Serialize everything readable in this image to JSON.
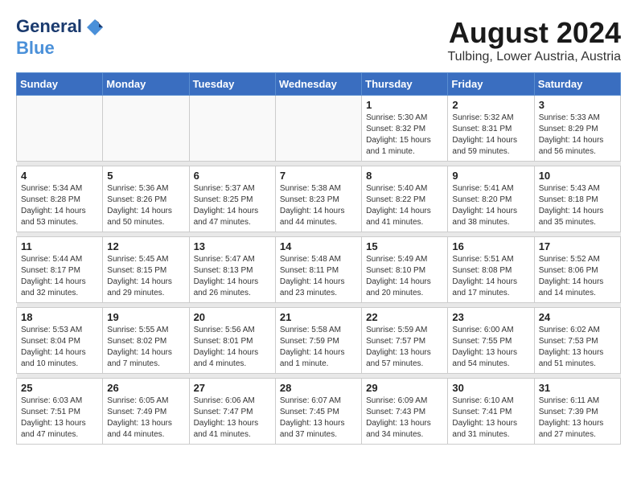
{
  "logo": {
    "line1": "General",
    "line2": "Blue"
  },
  "title": "August 2024",
  "location": "Tulbing, Lower Austria, Austria",
  "weekdays": [
    "Sunday",
    "Monday",
    "Tuesday",
    "Wednesday",
    "Thursday",
    "Friday",
    "Saturday"
  ],
  "weeks": [
    [
      {
        "day": "",
        "info": ""
      },
      {
        "day": "",
        "info": ""
      },
      {
        "day": "",
        "info": ""
      },
      {
        "day": "",
        "info": ""
      },
      {
        "day": "1",
        "info": "Sunrise: 5:30 AM\nSunset: 8:32 PM\nDaylight: 15 hours\nand 1 minute."
      },
      {
        "day": "2",
        "info": "Sunrise: 5:32 AM\nSunset: 8:31 PM\nDaylight: 14 hours\nand 59 minutes."
      },
      {
        "day": "3",
        "info": "Sunrise: 5:33 AM\nSunset: 8:29 PM\nDaylight: 14 hours\nand 56 minutes."
      }
    ],
    [
      {
        "day": "4",
        "info": "Sunrise: 5:34 AM\nSunset: 8:28 PM\nDaylight: 14 hours\nand 53 minutes."
      },
      {
        "day": "5",
        "info": "Sunrise: 5:36 AM\nSunset: 8:26 PM\nDaylight: 14 hours\nand 50 minutes."
      },
      {
        "day": "6",
        "info": "Sunrise: 5:37 AM\nSunset: 8:25 PM\nDaylight: 14 hours\nand 47 minutes."
      },
      {
        "day": "7",
        "info": "Sunrise: 5:38 AM\nSunset: 8:23 PM\nDaylight: 14 hours\nand 44 minutes."
      },
      {
        "day": "8",
        "info": "Sunrise: 5:40 AM\nSunset: 8:22 PM\nDaylight: 14 hours\nand 41 minutes."
      },
      {
        "day": "9",
        "info": "Sunrise: 5:41 AM\nSunset: 8:20 PM\nDaylight: 14 hours\nand 38 minutes."
      },
      {
        "day": "10",
        "info": "Sunrise: 5:43 AM\nSunset: 8:18 PM\nDaylight: 14 hours\nand 35 minutes."
      }
    ],
    [
      {
        "day": "11",
        "info": "Sunrise: 5:44 AM\nSunset: 8:17 PM\nDaylight: 14 hours\nand 32 minutes."
      },
      {
        "day": "12",
        "info": "Sunrise: 5:45 AM\nSunset: 8:15 PM\nDaylight: 14 hours\nand 29 minutes."
      },
      {
        "day": "13",
        "info": "Sunrise: 5:47 AM\nSunset: 8:13 PM\nDaylight: 14 hours\nand 26 minutes."
      },
      {
        "day": "14",
        "info": "Sunrise: 5:48 AM\nSunset: 8:11 PM\nDaylight: 14 hours\nand 23 minutes."
      },
      {
        "day": "15",
        "info": "Sunrise: 5:49 AM\nSunset: 8:10 PM\nDaylight: 14 hours\nand 20 minutes."
      },
      {
        "day": "16",
        "info": "Sunrise: 5:51 AM\nSunset: 8:08 PM\nDaylight: 14 hours\nand 17 minutes."
      },
      {
        "day": "17",
        "info": "Sunrise: 5:52 AM\nSunset: 8:06 PM\nDaylight: 14 hours\nand 14 minutes."
      }
    ],
    [
      {
        "day": "18",
        "info": "Sunrise: 5:53 AM\nSunset: 8:04 PM\nDaylight: 14 hours\nand 10 minutes."
      },
      {
        "day": "19",
        "info": "Sunrise: 5:55 AM\nSunset: 8:02 PM\nDaylight: 14 hours\nand 7 minutes."
      },
      {
        "day": "20",
        "info": "Sunrise: 5:56 AM\nSunset: 8:01 PM\nDaylight: 14 hours\nand 4 minutes."
      },
      {
        "day": "21",
        "info": "Sunrise: 5:58 AM\nSunset: 7:59 PM\nDaylight: 14 hours\nand 1 minute."
      },
      {
        "day": "22",
        "info": "Sunrise: 5:59 AM\nSunset: 7:57 PM\nDaylight: 13 hours\nand 57 minutes."
      },
      {
        "day": "23",
        "info": "Sunrise: 6:00 AM\nSunset: 7:55 PM\nDaylight: 13 hours\nand 54 minutes."
      },
      {
        "day": "24",
        "info": "Sunrise: 6:02 AM\nSunset: 7:53 PM\nDaylight: 13 hours\nand 51 minutes."
      }
    ],
    [
      {
        "day": "25",
        "info": "Sunrise: 6:03 AM\nSunset: 7:51 PM\nDaylight: 13 hours\nand 47 minutes."
      },
      {
        "day": "26",
        "info": "Sunrise: 6:05 AM\nSunset: 7:49 PM\nDaylight: 13 hours\nand 44 minutes."
      },
      {
        "day": "27",
        "info": "Sunrise: 6:06 AM\nSunset: 7:47 PM\nDaylight: 13 hours\nand 41 minutes."
      },
      {
        "day": "28",
        "info": "Sunrise: 6:07 AM\nSunset: 7:45 PM\nDaylight: 13 hours\nand 37 minutes."
      },
      {
        "day": "29",
        "info": "Sunrise: 6:09 AM\nSunset: 7:43 PM\nDaylight: 13 hours\nand 34 minutes."
      },
      {
        "day": "30",
        "info": "Sunrise: 6:10 AM\nSunset: 7:41 PM\nDaylight: 13 hours\nand 31 minutes."
      },
      {
        "day": "31",
        "info": "Sunrise: 6:11 AM\nSunset: 7:39 PM\nDaylight: 13 hours\nand 27 minutes."
      }
    ]
  ]
}
